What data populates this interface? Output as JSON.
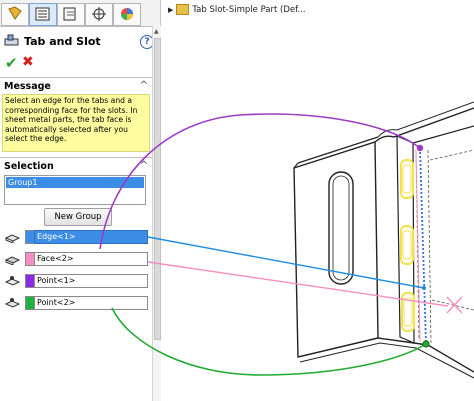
{
  "panel": {
    "title": "Tab and Slot",
    "help": "?",
    "ok": "✔",
    "cancel": "✖"
  },
  "message": {
    "header": "Message",
    "text": "Select an edge for the tabs and a corresponding face for the slots. In sheet metal parts, the tab face is automatically selected after you select the edge."
  },
  "selection": {
    "header": "Selection",
    "group_item": "Group1",
    "new_group_label": "New Group",
    "items": [
      {
        "label": "Edge<1>",
        "color": "#3c8de6"
      },
      {
        "label": "Face<2>",
        "color": "#f48fc0"
      },
      {
        "label": "Point<1>",
        "color": "#8a2be2"
      },
      {
        "label": "Point<2>",
        "color": "#20b040"
      }
    ]
  },
  "tree": {
    "label": "Tab Slot-Simple Part  (Def..."
  },
  "colors": {
    "edge": "#1e8fe0",
    "face": "#f48fc0",
    "point1": "#9a3cc4",
    "point2": "#22aa33",
    "highlight": "#f3e24a",
    "message_bg": "#fdfda0",
    "accent_blue": "#3c8de6"
  },
  "chevron": "^"
}
